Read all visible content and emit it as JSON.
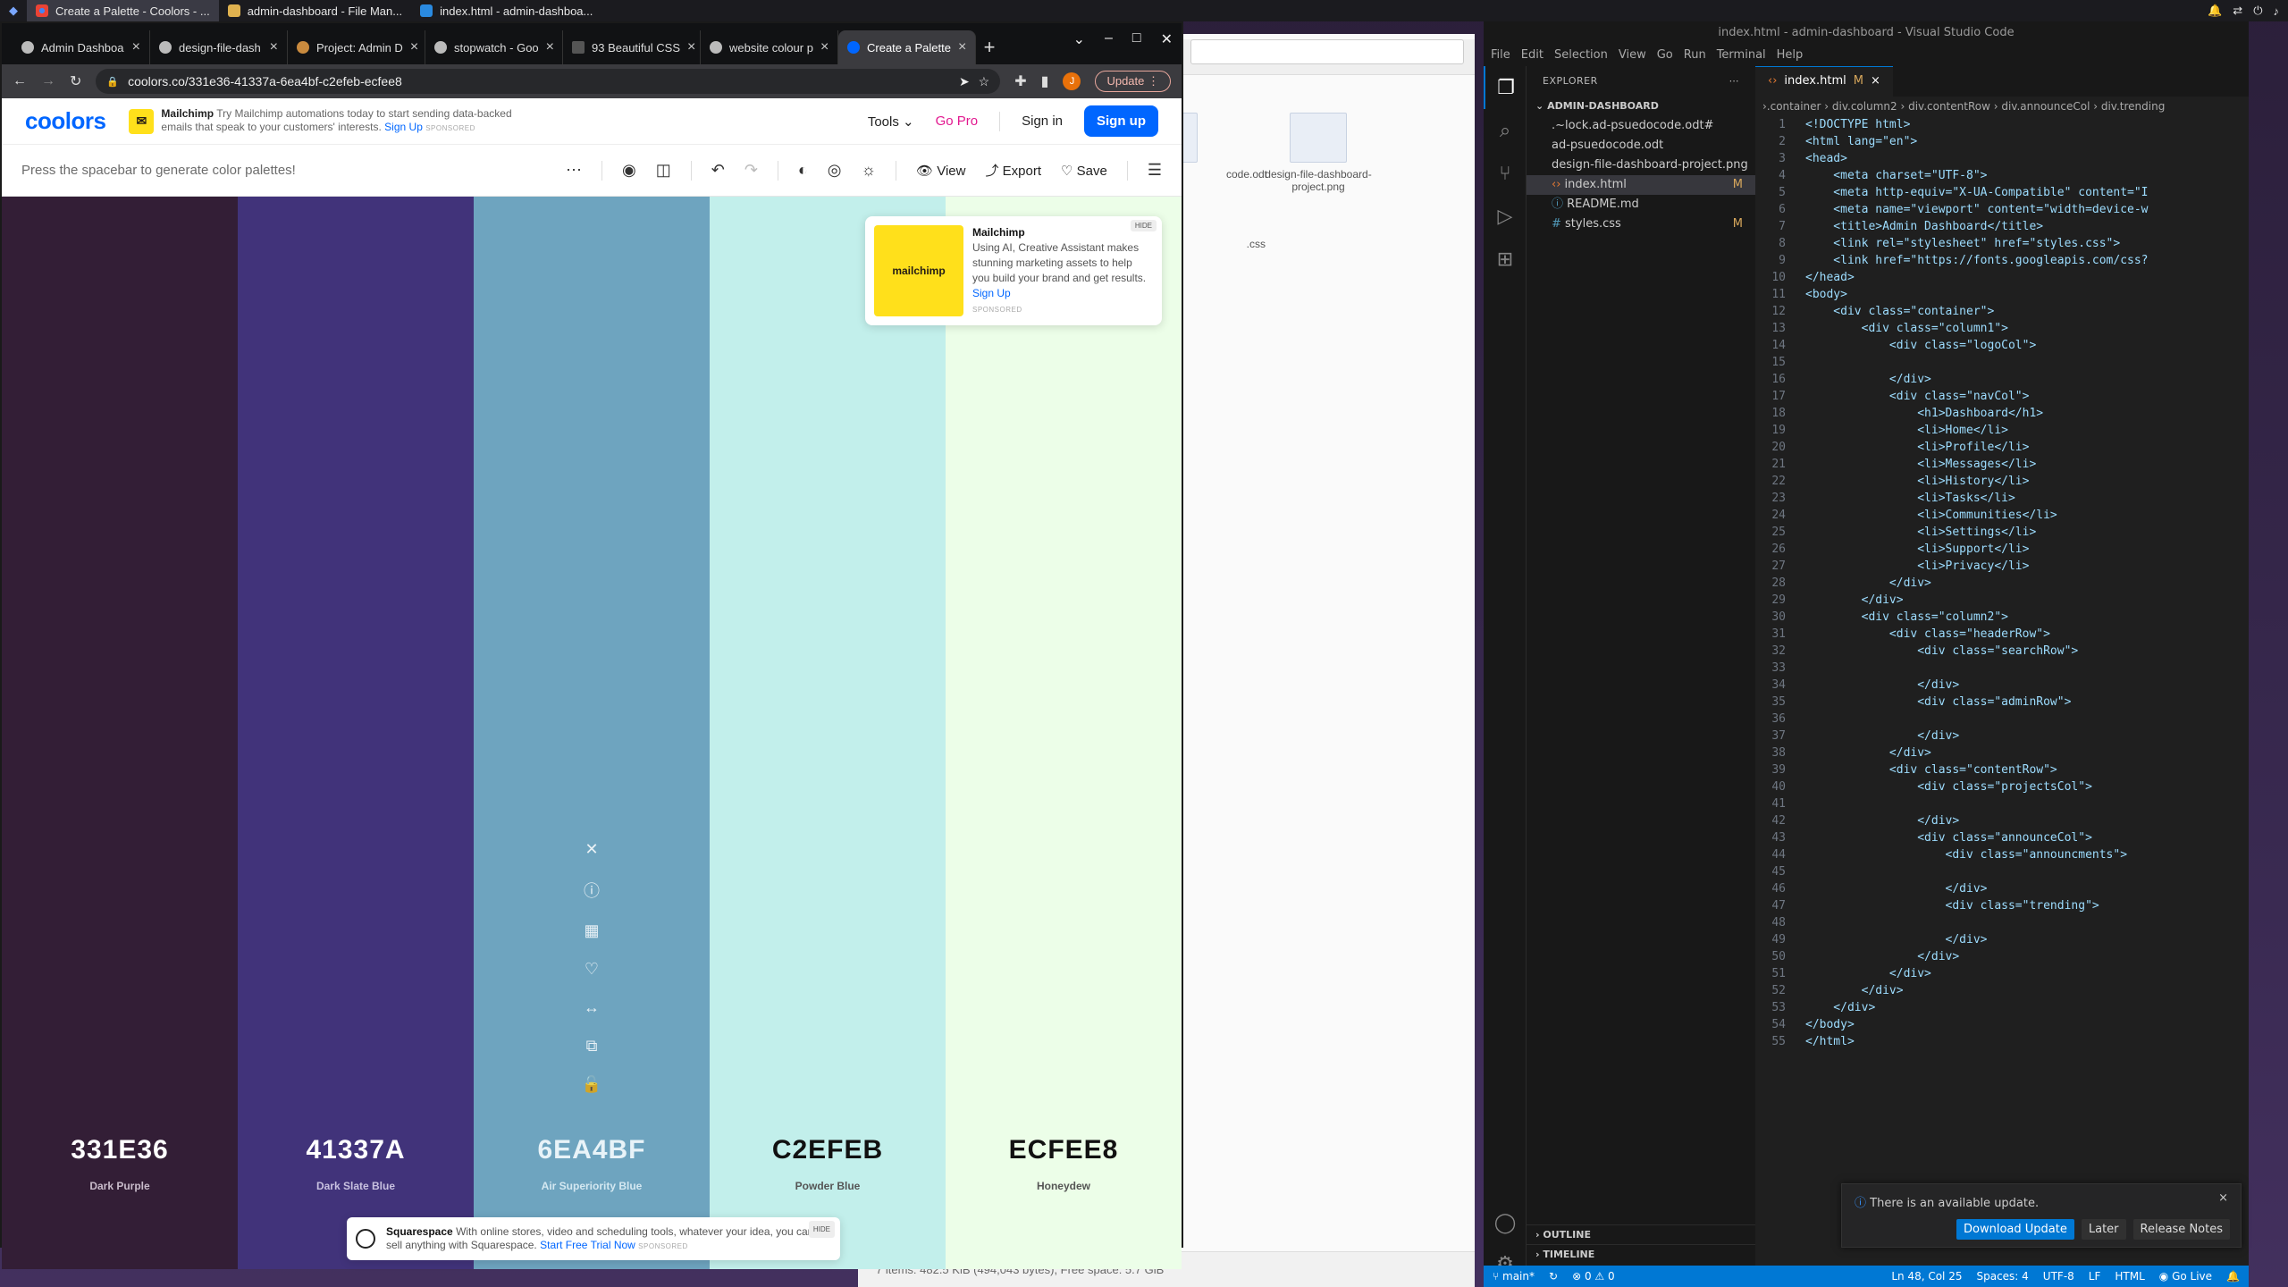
{
  "taskbar": {
    "apps": [
      {
        "label": "Create a Palette - Coolors - ...",
        "active": true
      },
      {
        "label": "admin-dashboard - File Man..."
      },
      {
        "label": "index.html - admin-dashboa..."
      }
    ]
  },
  "browser": {
    "tabs": [
      {
        "label": "Admin Dashboa"
      },
      {
        "label": "design-file-dash"
      },
      {
        "label": "Project: Admin D"
      },
      {
        "label": "stopwatch - Goo"
      },
      {
        "label": "93 Beautiful CSS"
      },
      {
        "label": "website colour p"
      },
      {
        "label": "Create a Palette",
        "active": true
      }
    ],
    "url": "coolors.co/331e36-41337a-6ea4bf-c2efeb-ecfee8",
    "update_label": "Update",
    "avatar_letter": "J"
  },
  "coolors": {
    "logo": "coolors",
    "ad_top": {
      "brand": "Mailchimp",
      "text": "Try Mailchimp automations today to start sending data-backed emails that speak to your customers' interests.",
      "cta": "Sign Up",
      "sponsored": "SPONSORED"
    },
    "nav": {
      "tools": "Tools",
      "gopro": "Go Pro",
      "signin": "Sign in",
      "signup": "Sign up"
    },
    "hint": "Press the spacebar to generate color palettes!",
    "toolbar": {
      "view": "View",
      "export": "Export",
      "save": "Save"
    },
    "swatches": [
      {
        "hex": "331E36",
        "name": "Dark Purple",
        "color": "#331e36",
        "text_color": "#ffffff",
        "name_color": "#c9bccb"
      },
      {
        "hex": "41337A",
        "name": "Dark Slate Blue",
        "color": "#41337a",
        "text_color": "#ffffff",
        "name_color": "#c8c1e0"
      },
      {
        "hex": "6EA4BF",
        "name": "Air Superiority Blue",
        "color": "#6ea4bf",
        "text_color": "#e8f3f8",
        "name_color": "#d4e8f1"
      },
      {
        "hex": "C2EFEB",
        "name": "Powder Blue",
        "color": "#c2efeb",
        "text_color": "#111111",
        "name_color": "#555555"
      },
      {
        "hex": "ECFEE8",
        "name": "Honeydew",
        "color": "#ecfee8",
        "text_color": "#111111",
        "name_color": "#555555"
      }
    ],
    "ad_card": {
      "brand": "Mailchimp",
      "text": "Using AI, Creative Assistant makes stunning marketing assets to help you build your brand and get results.",
      "cta": "Sign Up",
      "sponsored": "SPONSORED",
      "hide": "HIDE",
      "logo_text": "mailchimp"
    },
    "ad_bottom": {
      "brand": "Squarespace",
      "text": "With online stores, video and scheduling tools, whatever your idea, you can sell anything with Squarespace.",
      "cta": "Start Free Trial Now",
      "sponsored": "SPONSORED",
      "hide": "HIDE"
    }
  },
  "file_manager": {
    "files": [
      {
        "name": "code.odt"
      },
      {
        "name": "design-file-dashboard-project.png"
      },
      {
        "name": ".css"
      }
    ],
    "status": "7 items: 482.5 KiB (494,043 bytes), Free space: 5.7 GiB"
  },
  "vscode": {
    "title": "index.html - admin-dashboard - Visual Studio Code",
    "menu": [
      "File",
      "Edit",
      "Selection",
      "View",
      "Go",
      "Run",
      "Terminal",
      "Help"
    ],
    "explorer_header": "EXPLORER",
    "folder": "ADMIN-DASHBOARD",
    "files": [
      {
        "name": ".~lock.ad-psuedocode.odt#",
        "mark": ""
      },
      {
        "name": "ad-psuedocode.odt",
        "mark": ""
      },
      {
        "name": "design-file-dashboard-project.png",
        "mark": ""
      },
      {
        "name": "index.html",
        "mark": "M",
        "active": true
      },
      {
        "name": "README.md",
        "mark": ""
      },
      {
        "name": "styles.css",
        "mark": "M"
      }
    ],
    "outline": "OUTLINE",
    "timeline": "TIMELINE",
    "tab": {
      "name": "index.html",
      "mark": "M"
    },
    "breadcrumb": "›.container › div.column2 › div.contentRow › div.announceCol › div.trending",
    "code_lines": [
      "<!DOCTYPE html>",
      "<html lang=\"en\">",
      "<head>",
      "    <meta charset=\"UTF-8\">",
      "    <meta http-equiv=\"X-UA-Compatible\" content=\"I",
      "    <meta name=\"viewport\" content=\"width=device-w",
      "    <title>Admin Dashboard</title>",
      "    <link rel=\"stylesheet\" href=\"styles.css\">",
      "    <link href=\"https://fonts.googleapis.com/css?",
      "</head>",
      "<body>",
      "    <div class=\"container\">",
      "        <div class=\"column1\">",
      "            <div class=\"logoCol\">",
      "",
      "            </div>",
      "            <div class=\"navCol\">",
      "                <h1>Dashboard</h1>",
      "                <li>Home</li>",
      "                <li>Profile</li>",
      "                <li>Messages</li>",
      "                <li>History</li>",
      "                <li>Tasks</li>",
      "                <li>Communities</li>",
      "                <li>Settings</li>",
      "                <li>Support</li>",
      "                <li>Privacy</li>",
      "            </div>",
      "        </div>",
      "        <div class=\"column2\">",
      "            <div class=\"headerRow\">",
      "                <div class=\"searchRow\">",
      "",
      "                </div>",
      "                <div class=\"adminRow\">",
      "",
      "                </div>",
      "            </div>",
      "            <div class=\"contentRow\">",
      "                <div class=\"projectsCol\">",
      "",
      "                </div>",
      "                <div class=\"announceCol\">",
      "                    <div class=\"announcments\">",
      "",
      "                    </div>",
      "                    <div class=\"trending\">",
      "",
      "                    </div>",
      "                </div>",
      "            </div>",
      "        </div>",
      "    </div>",
      "</body>",
      "</html>"
    ],
    "notification": {
      "text": "There is an available update.",
      "download": "Download Update",
      "later": "Later",
      "release_notes": "Release Notes"
    },
    "status": {
      "branch": "main*",
      "problems": "0",
      "warnings": "0",
      "position": "Ln 48, Col 25",
      "spaces": "Spaces: 4",
      "encoding": "UTF-8",
      "eol": "LF",
      "language": "HTML",
      "golive": "Go Live"
    }
  }
}
